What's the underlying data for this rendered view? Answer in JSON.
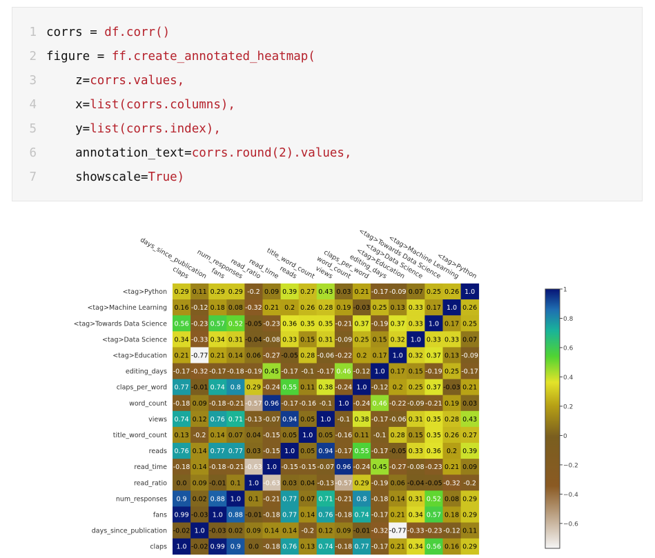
{
  "code": {
    "lines": [
      {
        "num": "1",
        "segments": [
          {
            "t": "corrs = ",
            "c": "plain"
          },
          {
            "t": "df.corr()",
            "c": "red"
          }
        ]
      },
      {
        "num": "2",
        "segments": [
          {
            "t": "figure = ",
            "c": "plain"
          },
          {
            "t": "ff.create_annotated_heatmap(",
            "c": "red"
          }
        ]
      },
      {
        "num": "3",
        "segments": [
          {
            "t": "    z=",
            "c": "plain"
          },
          {
            "t": "corrs.values,",
            "c": "red"
          }
        ]
      },
      {
        "num": "4",
        "segments": [
          {
            "t": "    x=",
            "c": "plain"
          },
          {
            "t": "list(corrs.columns),",
            "c": "red"
          }
        ]
      },
      {
        "num": "5",
        "segments": [
          {
            "t": "    y=",
            "c": "plain"
          },
          {
            "t": "list(corrs.index),",
            "c": "red"
          }
        ]
      },
      {
        "num": "6",
        "segments": [
          {
            "t": "    annotation_text=",
            "c": "plain"
          },
          {
            "t": "corrs.round(2).values,",
            "c": "red"
          }
        ]
      },
      {
        "num": "7",
        "segments": [
          {
            "t": "    showscale=",
            "c": "plain"
          },
          {
            "t": "True)",
            "c": "red"
          }
        ]
      }
    ]
  },
  "chart_data": {
    "type": "heatmap",
    "x": [
      "claps",
      "days_since_publication",
      "fans",
      "num_responses",
      "read_ratio",
      "read_time",
      "reads",
      "title_word_count",
      "views",
      "word_count",
      "claps_per_word",
      "editing_days",
      "<tag>Education",
      "<tag>Data Science",
      "<tag>Towards Data Science",
      "<tag>Machine Learning",
      "<tag>Python"
    ],
    "y": [
      "<tag>Python",
      "<tag>Machine Learning",
      "<tag>Towards Data Science",
      "<tag>Data Science",
      "<tag>Education",
      "editing_days",
      "claps_per_word",
      "word_count",
      "views",
      "title_word_count",
      "reads",
      "read_time",
      "read_ratio",
      "num_responses",
      "fans",
      "days_since_publication",
      "claps"
    ],
    "z": [
      [
        "0.29",
        "0.11",
        "0.29",
        "0.29",
        "-0.2",
        "0.09",
        "0.39",
        "0.27",
        "0.43",
        "0.03",
        "0.21",
        "-0.17",
        "-0.09",
        "0.07",
        "0.25",
        "0.26",
        "1.0"
      ],
      [
        "0.16",
        "-0.12",
        "0.18",
        "0.08",
        "-0.32",
        "0.21",
        "0.2",
        "0.26",
        "0.28",
        "0.19",
        "-0.03",
        "0.25",
        "0.13",
        "0.33",
        "0.17",
        "1.0",
        "0.26"
      ],
      [
        "0.56",
        "-0.23",
        "0.57",
        "0.52",
        "-0.05",
        "-0.23",
        "0.36",
        "0.35",
        "0.35",
        "-0.21",
        "0.37",
        "-0.19",
        "0.37",
        "0.33",
        "1.0",
        "0.17",
        "0.25"
      ],
      [
        "0.34",
        "-0.33",
        "0.34",
        "0.31",
        "-0.04",
        "-0.08",
        "0.33",
        "0.15",
        "0.31",
        "-0.09",
        "0.25",
        "0.15",
        "0.32",
        "1.0",
        "0.33",
        "0.33",
        "0.07"
      ],
      [
        "0.21",
        "-0.77",
        "0.21",
        "0.14",
        "0.06",
        "-0.27",
        "-0.05",
        "0.28",
        "-0.06",
        "-0.22",
        "0.2",
        "0.17",
        "1.0",
        "0.32",
        "0.37",
        "0.13",
        "-0.09"
      ],
      [
        "-0.17",
        "-0.32",
        "-0.17",
        "-0.18",
        "-0.19",
        "0.45",
        "-0.17",
        "-0.1",
        "-0.17",
        "0.46",
        "-0.12",
        "1.0",
        "0.17",
        "0.15",
        "-0.19",
        "0.25",
        "-0.17"
      ],
      [
        "0.77",
        "-0.01",
        "0.74",
        "0.8",
        "0.29",
        "-0.24",
        "0.55",
        "0.11",
        "0.38",
        "-0.24",
        "1.0",
        "-0.12",
        "0.2",
        "0.25",
        "0.37",
        "-0.03",
        "0.21"
      ],
      [
        "-0.18",
        "0.09",
        "-0.18",
        "-0.21",
        "-0.57",
        "0.96",
        "-0.17",
        "-0.16",
        "-0.1",
        "1.0",
        "-0.24",
        "0.46",
        "-0.22",
        "-0.09",
        "-0.21",
        "0.19",
        "0.03"
      ],
      [
        "0.74",
        "0.12",
        "0.76",
        "0.71",
        "-0.13",
        "-0.07",
        "0.94",
        "0.05",
        "1.0",
        "-0.1",
        "0.38",
        "-0.17",
        "-0.06",
        "0.31",
        "0.35",
        "0.28",
        "0.43"
      ],
      [
        "0.13",
        "-0.2",
        "0.14",
        "0.07",
        "0.04",
        "-0.15",
        "0.05",
        "1.0",
        "0.05",
        "-0.16",
        "0.11",
        "-0.1",
        "0.28",
        "0.15",
        "0.35",
        "0.26",
        "0.27"
      ],
      [
        "0.76",
        "0.14",
        "0.77",
        "0.77",
        "0.03",
        "-0.15",
        "1.0",
        "0.05",
        "0.94",
        "-0.17",
        "0.55",
        "-0.17",
        "-0.05",
        "0.33",
        "0.36",
        "0.2",
        "0.39"
      ],
      [
        "-0.18",
        "0.14",
        "-0.18",
        "-0.21",
        "-0.63",
        "1.0",
        "-0.15",
        "-0.15",
        "-0.07",
        "0.96",
        "-0.24",
        "0.45",
        "-0.27",
        "-0.08",
        "-0.23",
        "0.21",
        "0.09"
      ],
      [
        "0.0",
        "0.09",
        "-0.01",
        "0.1",
        "1.0",
        "-0.63",
        "0.03",
        "0.04",
        "-0.13",
        "-0.57",
        "0.29",
        "-0.19",
        "0.06",
        "-0.04",
        "-0.05",
        "-0.32",
        "-0.2"
      ],
      [
        "0.9",
        "0.02",
        "0.88",
        "1.0",
        "0.1",
        "-0.21",
        "0.77",
        "0.07",
        "0.71",
        "-0.21",
        "0.8",
        "-0.18",
        "0.14",
        "0.31",
        "0.52",
        "0.08",
        "0.29"
      ],
      [
        "0.99",
        "-0.03",
        "1.0",
        "0.88",
        "-0.01",
        "-0.18",
        "0.77",
        "0.14",
        "0.76",
        "-0.18",
        "0.74",
        "-0.17",
        "0.21",
        "0.34",
        "0.57",
        "0.18",
        "0.29"
      ],
      [
        "-0.02",
        "1.0",
        "-0.03",
        "0.02",
        "0.09",
        "0.14",
        "0.14",
        "-0.2",
        "0.12",
        "0.09",
        "-0.01",
        "-0.32",
        "-0.77",
        "-0.33",
        "-0.23",
        "-0.12",
        "0.11"
      ],
      [
        "1.0",
        "-0.02",
        "0.99",
        "0.9",
        "0.0",
        "-0.18",
        "0.76",
        "0.13",
        "0.74",
        "-0.18",
        "0.77",
        "-0.17",
        "0.21",
        "0.34",
        "0.56",
        "0.16",
        "0.29"
      ]
    ],
    "colorbar": {
      "ticks": [
        1,
        0.8,
        0.6,
        0.4,
        0.2,
        0,
        -0.2,
        -0.4,
        -0.6
      ],
      "tick_labels": [
        "1",
        "0.8",
        "0.6",
        "0.4",
        "0.2",
        "0",
        "−0.2",
        "−0.4",
        "−0.6"
      ],
      "range": [
        -0.77,
        1.0
      ],
      "colorscale": [
        [
          0.0,
          "#f5f5f5"
        ],
        [
          0.24,
          "#8a5a23"
        ],
        [
          0.43,
          "#7a5e1f"
        ],
        [
          0.55,
          "#b6a015"
        ],
        [
          0.64,
          "#e3e32a"
        ],
        [
          0.74,
          "#50d432"
        ],
        [
          0.84,
          "#19b39a"
        ],
        [
          0.92,
          "#1f6fb1"
        ],
        [
          1.0,
          "#061576"
        ]
      ]
    },
    "title": "",
    "xlabel": "",
    "ylabel": ""
  }
}
